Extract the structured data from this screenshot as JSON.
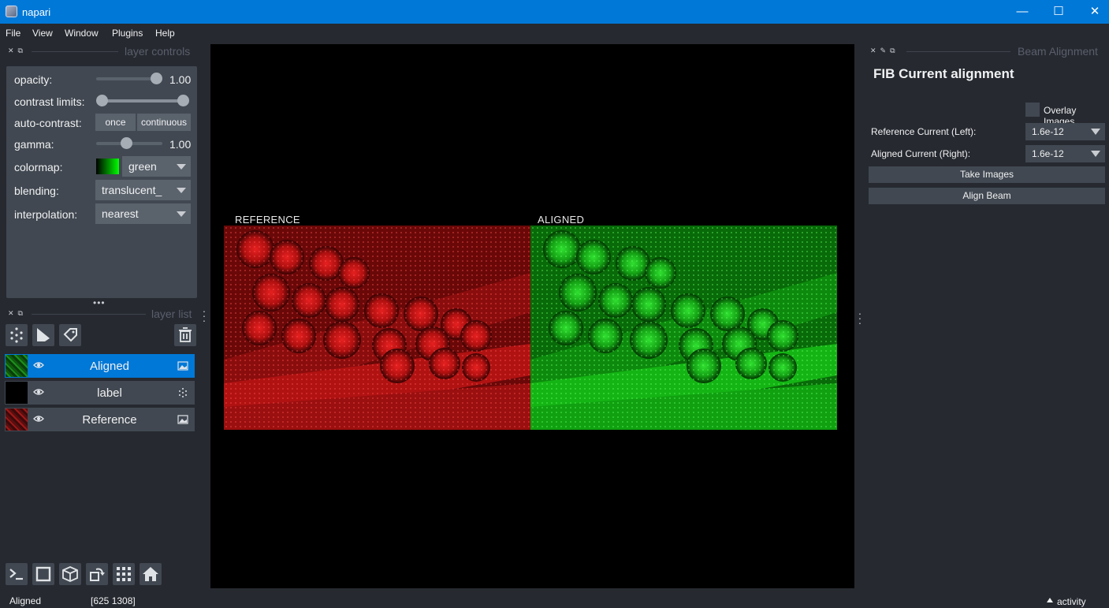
{
  "window": {
    "title": "napari",
    "minimize": "—",
    "maximize": "☐",
    "close": "✕"
  },
  "menu": [
    "File",
    "View",
    "Window",
    "Plugins",
    "Help"
  ],
  "layer_controls": {
    "header": "layer controls",
    "opacity_label": "opacity:",
    "opacity_value": "1.00",
    "contrast_label": "contrast limits:",
    "autocontrast_label": "auto-contrast:",
    "once_button": "once",
    "continuous_button": "continuous",
    "gamma_label": "gamma:",
    "gamma_value": "1.00",
    "colormap_label": "colormap:",
    "colormap_value": "green",
    "blending_label": "blending:",
    "blending_value": "translucent_",
    "interpolation_label": "interpolation:",
    "interpolation_value": "nearest"
  },
  "layer_list": {
    "header": "layer list",
    "layers": [
      {
        "name": "Aligned",
        "selected": true,
        "type": "image"
      },
      {
        "name": "label",
        "selected": false,
        "type": "points"
      },
      {
        "name": "Reference",
        "selected": false,
        "type": "image"
      }
    ]
  },
  "canvas": {
    "left_label": "REFERENCE",
    "right_label": "ALIGNED"
  },
  "status": {
    "layer": "Aligned",
    "coords": "[625 1308]",
    "activity": "activity"
  },
  "beam_alignment": {
    "header": "Beam Alignment",
    "title": "FIB Current alignment",
    "overlay_label": "Overlay Images",
    "reference_label": "Reference Current (Left):",
    "reference_value": "1.6e-12",
    "aligned_label": "Aligned Current (Right):",
    "aligned_value": "1.6e-12",
    "take_images": "Take Images",
    "align_beam": "Align Beam"
  },
  "colors": {
    "accent": "#0078d7",
    "background": "#262930",
    "panel": "#414851"
  }
}
